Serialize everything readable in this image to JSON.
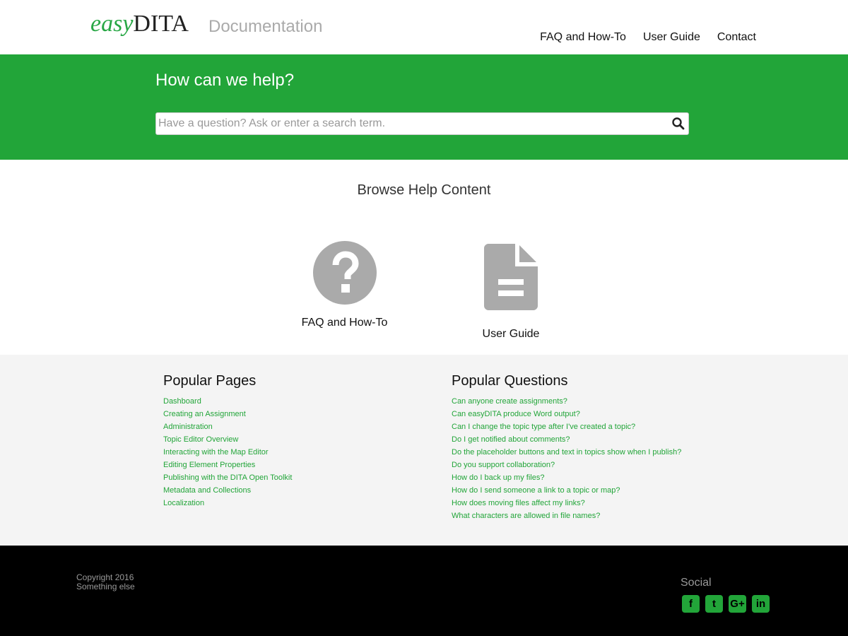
{
  "header": {
    "logo": {
      "easy": "easy",
      "dita": "DITA"
    },
    "doc_title": "Documentation",
    "nav": [
      "FAQ and How-To",
      "User Guide",
      "Contact"
    ]
  },
  "hero": {
    "title": "How can we help?",
    "search_placeholder": "Have a question? Ask or enter a search term.",
    "search_icon": "search-icon"
  },
  "browse": {
    "title": "Browse Help Content",
    "tiles": [
      {
        "label": "FAQ and How-To",
        "icon": "question-circle-icon"
      },
      {
        "label": "User Guide",
        "icon": "document-icon"
      }
    ]
  },
  "popular_pages": {
    "title": "Popular Pages",
    "items": [
      "Dashboard",
      "Creating an Assignment",
      "Administration",
      "Topic Editor Overview",
      "Interacting with the Map Editor",
      "Editing Element Properties",
      "Publishing with the DITA Open Toolkit",
      "Metadata and Collections",
      "Localization"
    ]
  },
  "popular_questions": {
    "title": "Popular Questions",
    "items": [
      "Can anyone create assignments?",
      "Can easyDITA produce Word output?",
      "Can I change the topic type after I've created a topic?",
      "Do I get notified about comments?",
      "Do the placeholder buttons and text in topics show when I publish?",
      "Do you support collaboration?",
      "How do I back up my files?",
      "How do I send someone a link to a topic or map?",
      "How does moving files affect my links?",
      "What characters are allowed in file names?"
    ]
  },
  "footer": {
    "copyright": "Copyright 2016",
    "line2": "Something else",
    "social_title": "Social",
    "social_icons": [
      "facebook-icon",
      "twitter-icon",
      "google-plus-icon",
      "linkedin-icon"
    ],
    "social_glyphs": [
      "f",
      "t",
      "G+",
      "in"
    ]
  },
  "colors": {
    "brand_green": "#22a539",
    "footer_bg": "#000000",
    "light_bg": "#f4f4f4"
  }
}
